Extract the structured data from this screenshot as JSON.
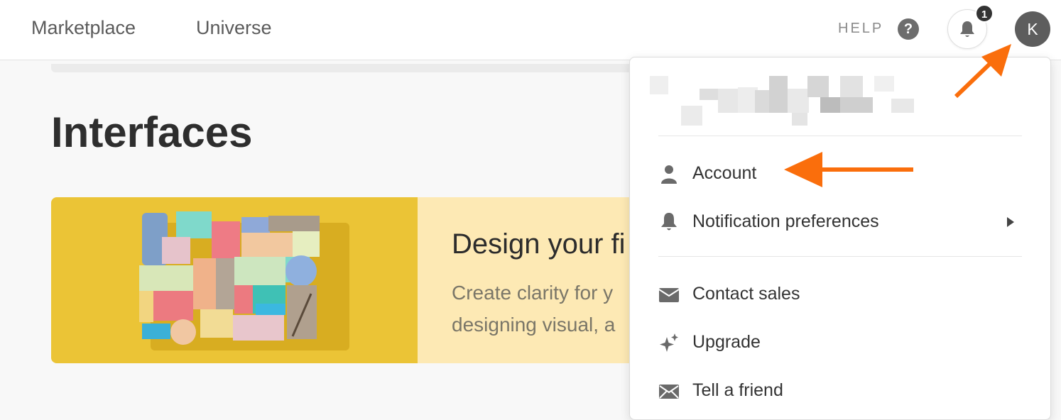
{
  "nav": {
    "marketplace": "Marketplace",
    "universe": "Universe"
  },
  "header": {
    "help_label": "HELP",
    "help_icon_glyph": "?",
    "notification_count": "1",
    "avatar_initial": "K"
  },
  "page": {
    "title": "Interfaces"
  },
  "hero": {
    "title": "Design your fi",
    "description_line1": "Create clarity for y",
    "description_line2": "designing visual, a"
  },
  "menu": {
    "items": [
      {
        "label": "Account",
        "icon": "person-icon"
      },
      {
        "label": "Notification preferences",
        "icon": "bell-icon",
        "has_submenu": true
      },
      {
        "label": "Contact sales",
        "icon": "envelope-icon"
      },
      {
        "label": "Upgrade",
        "icon": "sparkle-icon"
      },
      {
        "label": "Tell a friend",
        "icon": "mail-icon"
      }
    ]
  },
  "colors": {
    "accent_arrow": "#fa6e0c",
    "hero_yellow": "#ebc436",
    "hero_cream": "#fde9b4",
    "avatar": "#5d5d5d"
  }
}
